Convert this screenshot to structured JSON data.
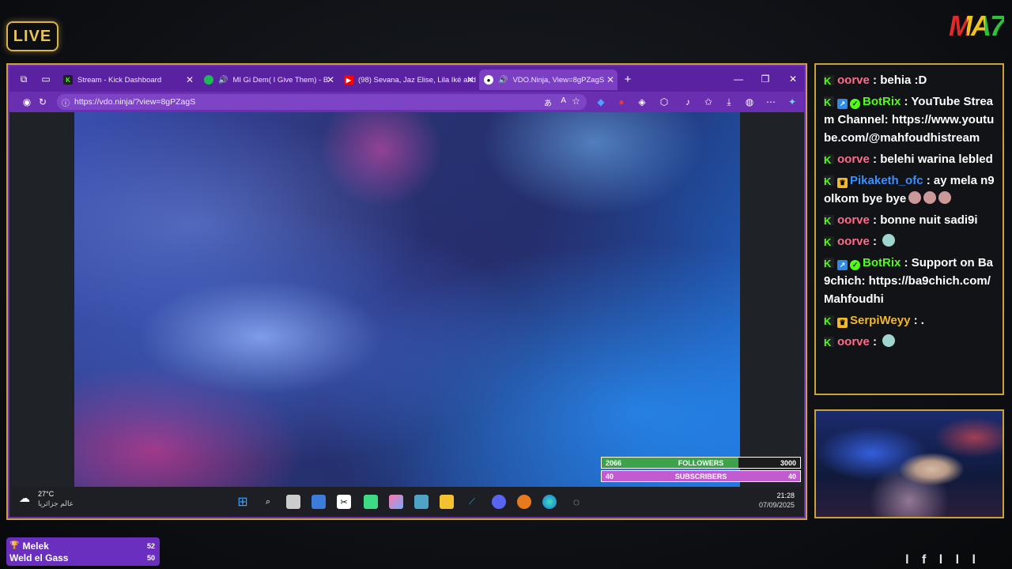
{
  "overlay": {
    "live_label": "LIVE",
    "logo_text": "MA7",
    "bottom_ticker": "l f l l l"
  },
  "browser": {
    "tabs": [
      {
        "label": "Stream - Kick Dashboard",
        "icon": "kick-icon"
      },
      {
        "label": "MI Gi Dem( I Give Them) - B",
        "icon": "spotify-icon"
      },
      {
        "label": "(98) Sevana, Jaz Elise, Lila Iké and",
        "icon": "youtube-icon"
      },
      {
        "label": "VDO.Ninja, View=8gPZagS",
        "icon": "vdo-ninja-icon"
      }
    ],
    "url": "https://vdo.ninja/?view=8gPZagS"
  },
  "stats": {
    "followers": {
      "current": "2066",
      "label": "FOLLOWERS",
      "goal": "3000"
    },
    "subscribers": {
      "current": "40",
      "label": "SUBSCRIBERS",
      "goal": "40"
    }
  },
  "taskbar": {
    "weather_temp": "27°C",
    "weather_text": "عالم جزائريا",
    "time": "21:28",
    "date": "07/09/2025"
  },
  "chat": [
    {
      "user": "oorve",
      "color": "#ff6b8a",
      "text": "behia :D"
    },
    {
      "user": "BotRix",
      "color": "#53fc18",
      "text": "YouTube Stream Channel: https://www.youtube.com/@mahfoudhistream"
    },
    {
      "user": "oorve",
      "color": "#ff6b8a",
      "text": "belehi warina lebled"
    },
    {
      "user": "Pikaketh_ofc",
      "color": "#3b8fff",
      "text": "ay mela n9olkom bye bye"
    },
    {
      "user": "oorve",
      "color": "#ff6b8a",
      "text": "bonne nuit sadi9i"
    },
    {
      "user": "oorve",
      "color": "#ff6b8a",
      "text": ""
    },
    {
      "user": "BotRix",
      "color": "#53fc18",
      "text": "Support on Ba9chich: https://ba9chich.com/Mahfoudhi"
    },
    {
      "user": "SerpiWeyy",
      "color": "#f1b82d",
      "text": "."
    },
    {
      "user": "oorve",
      "color": "#ff6b8a",
      "text": ""
    }
  ],
  "vip": [
    {
      "name": "Melek",
      "value": "52"
    },
    {
      "name": "Weld el Gass",
      "value": "50"
    }
  ]
}
